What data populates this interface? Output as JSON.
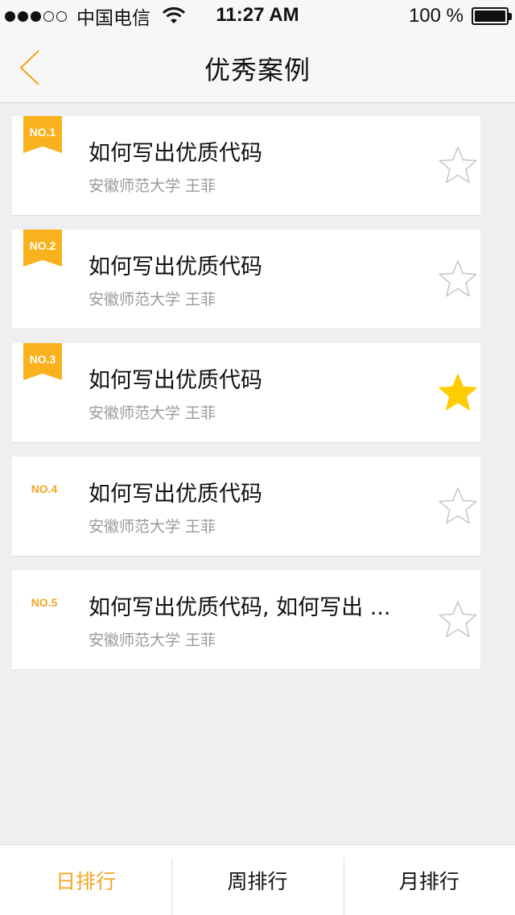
{
  "status_bar": {
    "carrier": "中国电信",
    "time": "11:27 AM",
    "battery_percent": "100 %",
    "signal_bars_filled": 3,
    "signal_bars_total": 5
  },
  "nav": {
    "title": "优秀案例",
    "back_icon": "chevron-left-icon"
  },
  "colors": {
    "accent": "#f5a623",
    "ribbon": "#f9b21e",
    "star_filled": "#ffcc00",
    "star_empty_stroke": "#c8c8c8"
  },
  "cases": [
    {
      "rank": "NO.1",
      "title": "如何写出优质代码",
      "subtitle": "安徽师范大学 王菲",
      "ribbon": true,
      "favorited": false
    },
    {
      "rank": "NO.2",
      "title": "如何写出优质代码",
      "subtitle": "安徽师范大学 王菲",
      "ribbon": true,
      "favorited": false
    },
    {
      "rank": "NO.3",
      "title": "如何写出优质代码",
      "subtitle": "安徽师范大学 王菲",
      "ribbon": true,
      "favorited": true
    },
    {
      "rank": "NO.4",
      "title": "如何写出优质代码",
      "subtitle": "安徽师范大学 王菲",
      "ribbon": false,
      "favorited": false
    },
    {
      "rank": "NO.5",
      "title": "如何写出优质代码, 如何写出 ...",
      "subtitle": "安徽师范大学 王菲",
      "ribbon": false,
      "favorited": false
    }
  ],
  "tabs": [
    {
      "label": "日排行",
      "active": true
    },
    {
      "label": "周排行",
      "active": false
    },
    {
      "label": "月排行",
      "active": false
    }
  ]
}
